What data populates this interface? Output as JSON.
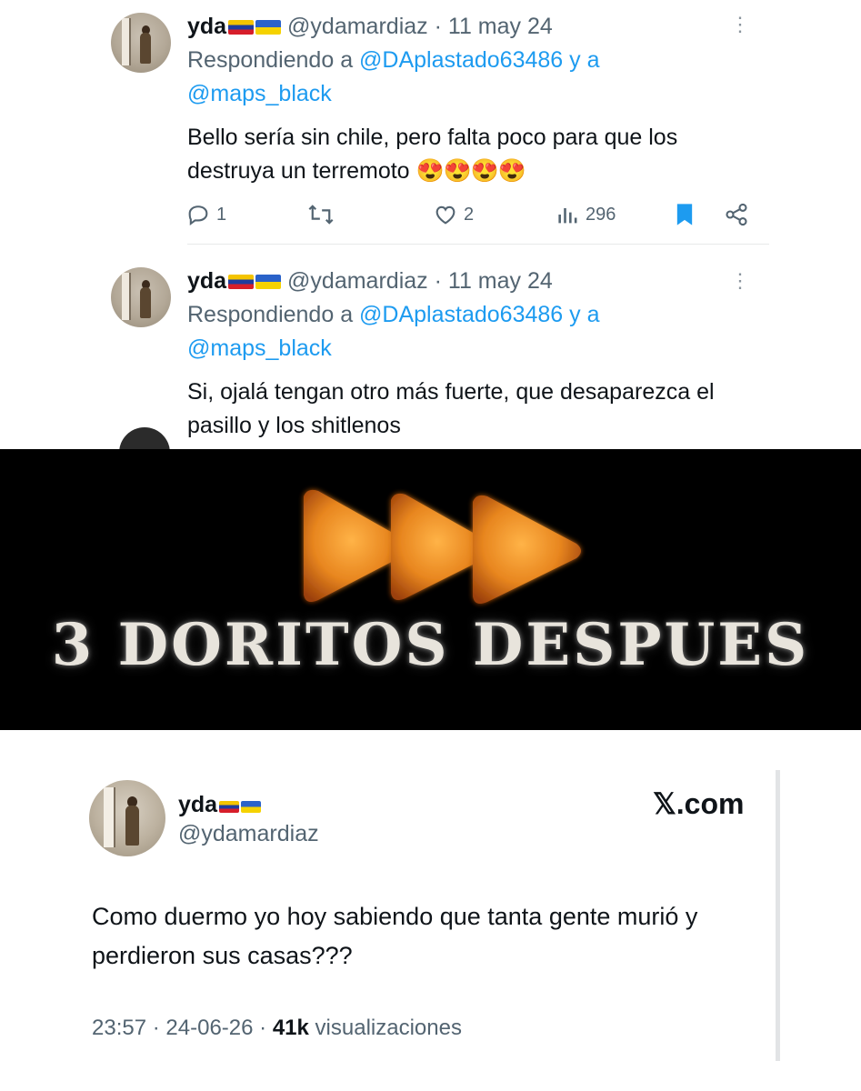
{
  "tweets": [
    {
      "name": "yda",
      "handle": "@ydamardiaz",
      "date": "11 may 24",
      "replying_prefix": "Respondiendo a",
      "replying_user1": "@DAplastado63486",
      "replying_and": "y a",
      "replying_user2": "@maps_black",
      "text": "Bello sería sin chile, pero falta poco para que los destruya un terremoto",
      "emojis": "😍😍😍😍",
      "replies": "1",
      "likes": "2",
      "views": "296",
      "icons": [
        "reply-icon",
        "retweet-icon",
        "heart-icon",
        "views-icon",
        "bookmark-icon",
        "share-icon"
      ]
    },
    {
      "name": "yda",
      "handle": "@ydamardiaz",
      "date": "11 may 24",
      "replying_prefix": "Respondiendo a",
      "replying_user1": "@DAplastado63486",
      "replying_and": "y a",
      "replying_user2": "@maps_black",
      "text": "Si, ojalá tengan otro más fuerte, que desaparezca el pasillo y los shitlenos"
    }
  ],
  "banner": {
    "text": "3 DORITOS DESPUES",
    "chip_color": "#e07a1f"
  },
  "card": {
    "name": "yda",
    "handle": "@ydamardiaz",
    "brand": "𝕏.com",
    "text": "Como duermo yo hoy sabiendo que tanta gente murió y perdieron sus casas???",
    "time": "23:57",
    "date": "24-06-26",
    "views": "41k",
    "views_label": "visualizaciones"
  },
  "colors": {
    "link": "#1d9bf0",
    "muted": "#536471",
    "text": "#0f1419",
    "flag_ve": [
      "#f4c400",
      "#1f3c9e",
      "#d71e2a"
    ],
    "flag_ua": [
      "#2a62c9",
      "#f5d200"
    ]
  }
}
